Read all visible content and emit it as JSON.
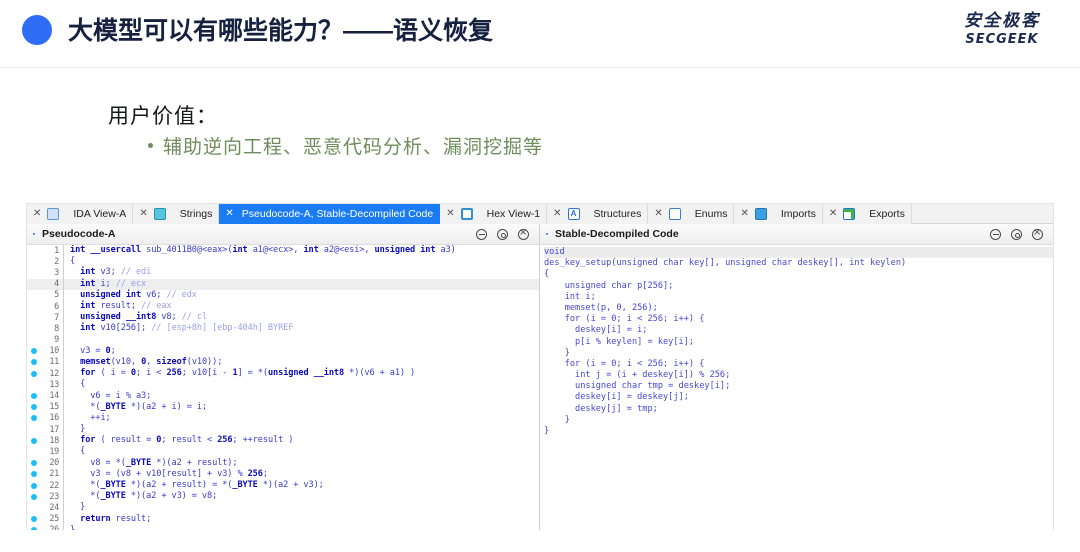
{
  "header": {
    "title": "大模型可以有哪些能力？——语义恢复",
    "logo_cn": "安全极客",
    "logo_en": "SECGEEK",
    "accent": "#2f6df6"
  },
  "content": {
    "lead": "用户价值：",
    "bullet": "辅助逆向工程、恶意代码分析、漏洞挖掘等",
    "bullet_color": "#6f8d5c"
  },
  "ida": {
    "tabs": [
      {
        "label": "IDA View-A",
        "icon": "ida-view-icon",
        "active": false,
        "closable": true
      },
      {
        "label": "Strings",
        "icon": "strings-icon",
        "active": false,
        "closable": true
      },
      {
        "label": "Pseudocode-A, Stable-Decompiled Code",
        "icon": "pseudocode-icon",
        "active": true,
        "closable": true
      },
      {
        "label": "Hex View-1",
        "icon": "hex-view-icon",
        "active": false,
        "closable": true
      },
      {
        "label": "Structures",
        "icon": "structures-icon",
        "active": false,
        "closable": true
      },
      {
        "label": "Enums",
        "icon": "enums-icon",
        "active": false,
        "closable": true
      },
      {
        "label": "Imports",
        "icon": "imports-icon",
        "active": false,
        "closable": true
      },
      {
        "label": "Exports",
        "icon": "exports-icon",
        "active": false,
        "closable": true
      }
    ],
    "active_tab_color": "#1a7bf2",
    "left_pane": {
      "title": "Pseudocode-A",
      "controls": [
        "minimize",
        "maximize",
        "close"
      ],
      "highlighted_line": 4,
      "breakpoint_lines": [
        10,
        11,
        12,
        14,
        15,
        16,
        18,
        20,
        21,
        22,
        23,
        25,
        26
      ],
      "lines": [
        {
          "n": 1,
          "text": "int __usercall sub_4011B0@<eax>(int a1@<ecx>, int a2@<esi>, unsigned int a3)"
        },
        {
          "n": 2,
          "text": "{"
        },
        {
          "n": 3,
          "text": "  int v3; // edi"
        },
        {
          "n": 4,
          "text": "  int i; // ecx"
        },
        {
          "n": 5,
          "text": "  unsigned int v6; // edx"
        },
        {
          "n": 6,
          "text": "  int result; // eax"
        },
        {
          "n": 7,
          "text": "  unsigned __int8 v8; // cl"
        },
        {
          "n": 8,
          "text": "  int v10[256]; // [esp+8h] [ebp-404h] BYREF"
        },
        {
          "n": 9,
          "text": ""
        },
        {
          "n": 10,
          "text": "  v3 = 0;"
        },
        {
          "n": 11,
          "text": "  memset(v10, 0, sizeof(v10));"
        },
        {
          "n": 12,
          "text": "  for ( i = 0; i < 256; v10[i - 1] = *(unsigned __int8 *)(v6 + a1) )"
        },
        {
          "n": 13,
          "text": "  {"
        },
        {
          "n": 14,
          "text": "    v6 = i % a3;"
        },
        {
          "n": 15,
          "text": "    *(_BYTE *)(a2 + i) = i;"
        },
        {
          "n": 16,
          "text": "    ++i;"
        },
        {
          "n": 17,
          "text": "  }"
        },
        {
          "n": 18,
          "text": "  for ( result = 0; result < 256; ++result )"
        },
        {
          "n": 19,
          "text": "  {"
        },
        {
          "n": 20,
          "text": "    v8 = *(_BYTE *)(a2 + result);"
        },
        {
          "n": 21,
          "text": "    v3 = (v8 + v10[result] + v3) % 256;"
        },
        {
          "n": 22,
          "text": "    *(_BYTE *)(a2 + result) = *(_BYTE *)(a2 + v3);"
        },
        {
          "n": 23,
          "text": "    *(_BYTE *)(a2 + v3) = v8;"
        },
        {
          "n": 24,
          "text": "  }"
        },
        {
          "n": 25,
          "text": "  return result;"
        },
        {
          "n": 26,
          "text": "}"
        }
      ]
    },
    "right_pane": {
      "title": "Stable-Decompiled Code",
      "controls": [
        "minimize",
        "maximize",
        "close"
      ],
      "highlighted_line": 1,
      "lines": [
        "void",
        "des_key_setup(unsigned char key[], unsigned char deskey[], int keylen)",
        "{",
        "    unsigned char p[256];",
        "    int i;",
        "    memset(p, 0, 256);",
        "    for (i = 0; i < 256; i++) {",
        "      deskey[i] = i;",
        "      p[i % keylen] = key[i];",
        "    }",
        "    for (i = 0; i < 256; i++) {",
        "      int j = (i + deskey[i]) % 256;",
        "      unsigned char tmp = deskey[i];",
        "      deskey[i] = deskey[j];",
        "      deskey[j] = tmp;",
        "    }",
        "}"
      ]
    }
  }
}
